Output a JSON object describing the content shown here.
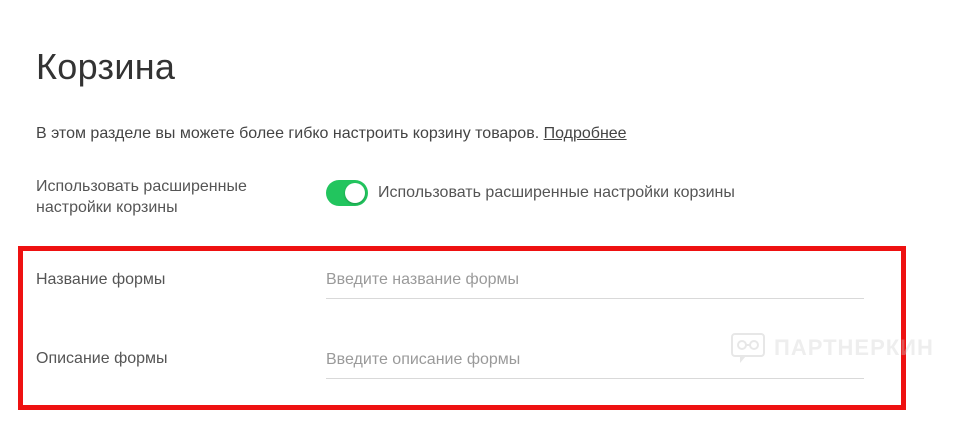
{
  "page": {
    "title": "Корзина"
  },
  "intro": {
    "text": "В этом разделе вы можете более гибко настроить корзину товаров. ",
    "link_label": "Подробнее"
  },
  "advanced_settings": {
    "label": "Использовать расширенные настройки корзины",
    "toggle_on": true,
    "toggle_text": "Использовать расширенные настройки корзины",
    "toggle_color": "#22c55e"
  },
  "form": {
    "name_label": "Название формы",
    "name_placeholder": "Введите название формы",
    "description_label": "Описание формы",
    "description_placeholder": "Введите описание формы"
  },
  "highlight": {
    "color": "#ee1111"
  },
  "watermark": {
    "text": "ПАРТНЕРКИН",
    "icon": "glasses-bubble-icon"
  }
}
